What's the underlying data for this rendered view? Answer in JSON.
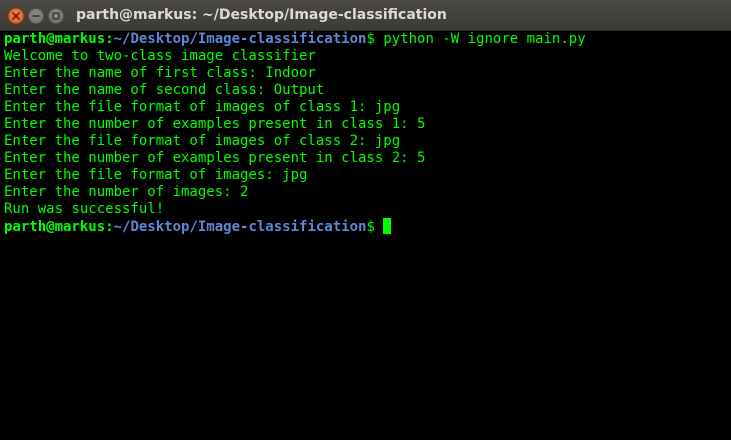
{
  "window": {
    "title": "parth@markus: ~/Desktop/Image-classification"
  },
  "colors": {
    "output_text": "#00ff00",
    "prompt_user": "#00ff00",
    "prompt_path": "#5f87d7",
    "background": "#000000",
    "titlebar": "#3c3b37",
    "close_button": "#e2531b"
  },
  "icons": {
    "close": "close-icon",
    "minimize": "minimize-icon",
    "maximize": "maximize-icon"
  },
  "terminal": {
    "prompt1": {
      "user_host": "parth@markus",
      "separator": ":",
      "path": "~/Desktop/Image-classification",
      "symbol": "$",
      "command": " python -W ignore main.py"
    },
    "output": [
      "Welcome to two-class image classifier",
      "Enter the name of first class: Indoor",
      "Enter the name of second class: Output",
      "Enter the file format of images of class 1: jpg",
      "Enter the number of examples present in class 1: 5",
      "Enter the file format of images of class 2: jpg",
      "Enter the number of examples present in class 2: 5",
      "Enter the file format of images: jpg",
      "Enter the number of images: 2",
      "Run was successful!"
    ],
    "prompt2": {
      "user_host": "parth@markus",
      "separator": ":",
      "path": "~/Desktop/Image-classification",
      "symbol": "$",
      "command": " "
    }
  }
}
